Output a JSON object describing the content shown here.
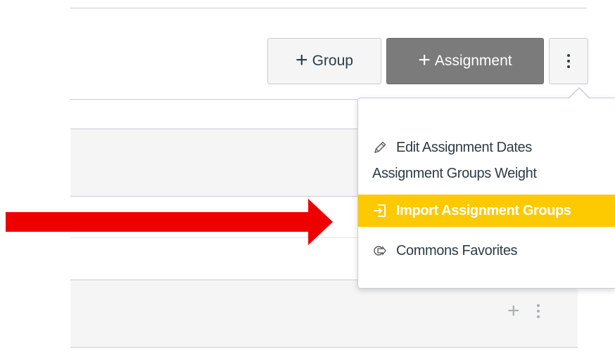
{
  "toolbar": {
    "group_label": "Group",
    "assignment_label": "Assignment"
  },
  "settings_menu": {
    "items": [
      {
        "label": "Edit Assignment Dates",
        "icon": "pencil-icon"
      },
      {
        "label": "Assignment Groups Weight",
        "icon": ""
      },
      {
        "label": "Import Assignment Groups",
        "icon": "import-icon",
        "highlighted": true
      },
      {
        "label": "Commons Favorites",
        "icon": "commons-icon"
      }
    ]
  },
  "annotation": {
    "arrow_color": "#ee0000"
  },
  "colors": {
    "highlight": "#fdc900",
    "primary_button": "#7b7b7b",
    "text": "#2d3b45",
    "border": "#c7cdd1"
  }
}
